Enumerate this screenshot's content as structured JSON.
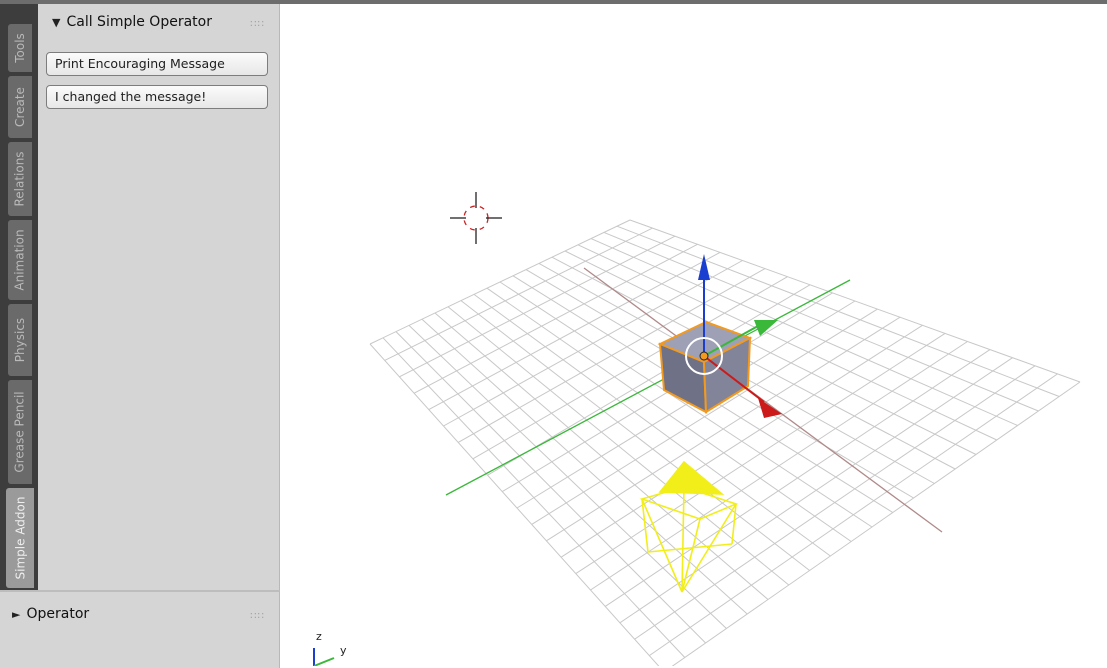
{
  "tool_shelf": {
    "tabs": [
      "Tools",
      "Create",
      "Relations",
      "Animation",
      "Physics",
      "Grease Pencil",
      "Simple Addon"
    ],
    "active_tab": "Simple Addon",
    "panel": {
      "title": "Call Simple Operator",
      "buttons": [
        "Print Encouraging Message",
        "I changed the message!"
      ]
    }
  },
  "operator_panel": {
    "title": "Operator"
  },
  "viewport": {
    "axis_labels": {
      "z": "z",
      "y": "y"
    },
    "colors": {
      "x_axis": "#cc1a1a",
      "y_axis": "#3ab83a",
      "z_axis": "#1a3fd0",
      "selection": "#f29a20",
      "camera": "#f2ee1a",
      "grid": "#c8c8c8"
    }
  }
}
